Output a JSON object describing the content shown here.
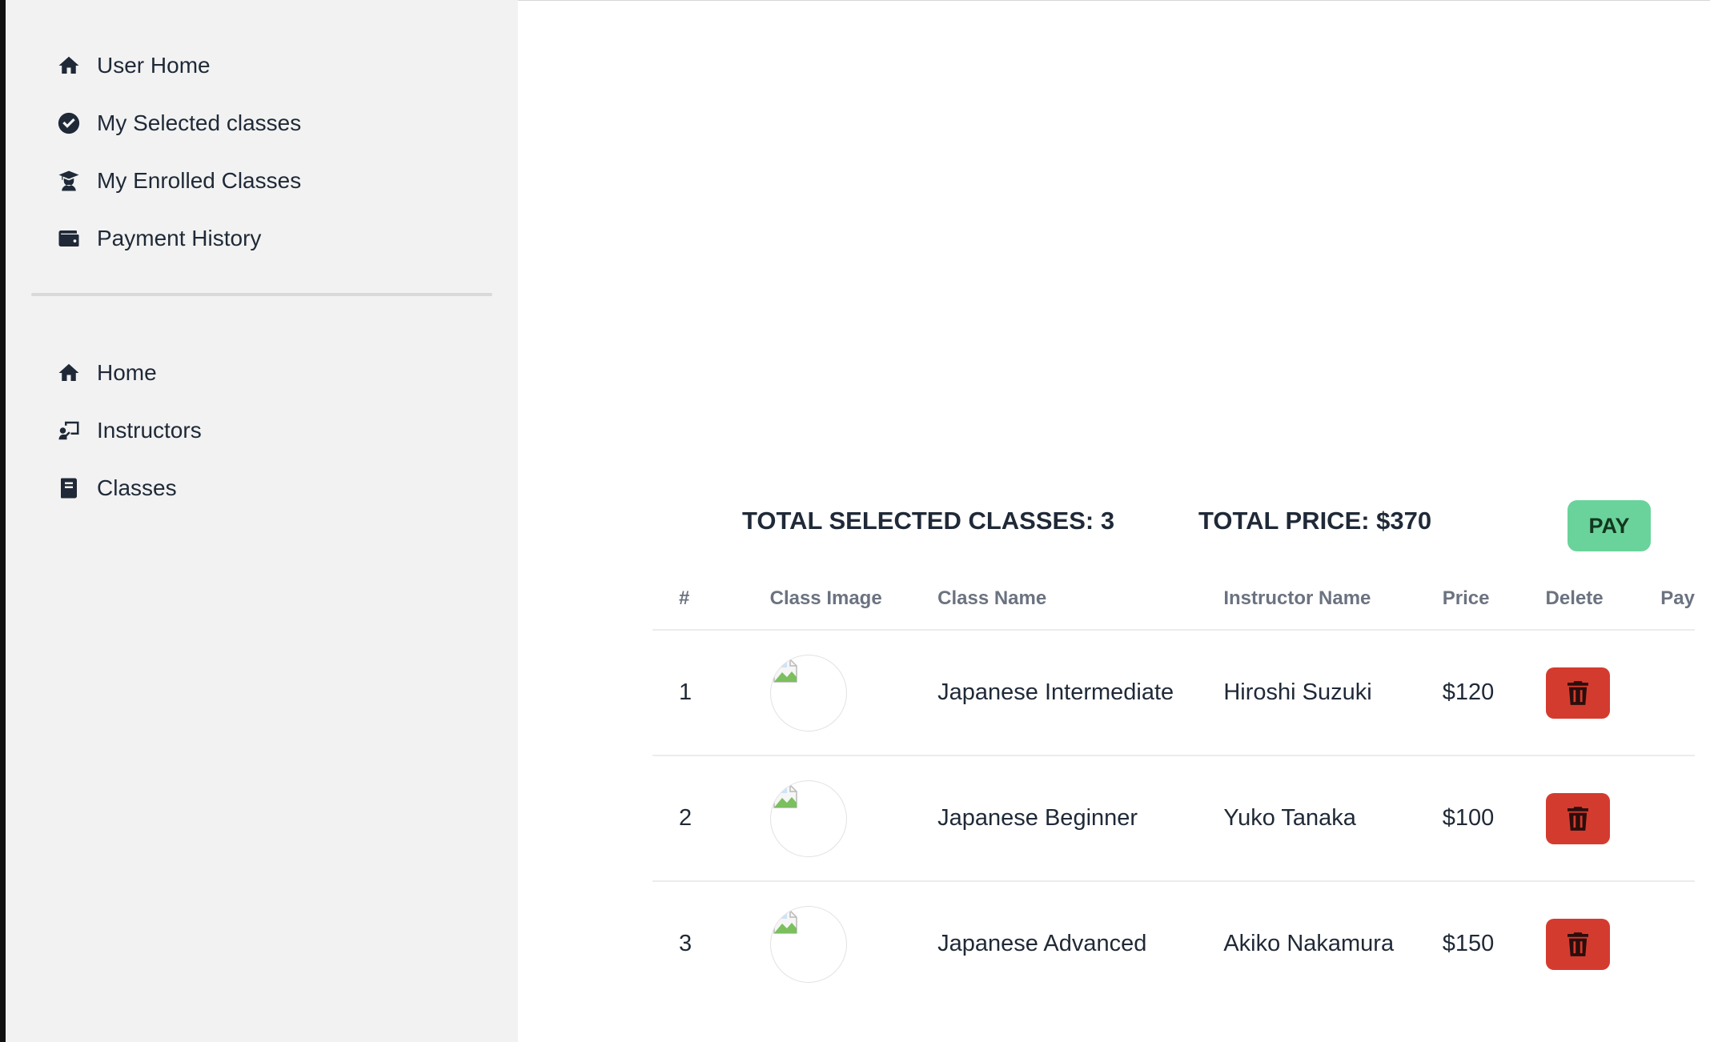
{
  "sidebar": {
    "primary": [
      {
        "label": "User Home",
        "icon": "home-icon"
      },
      {
        "label": "My Selected classes",
        "icon": "check-circle-icon"
      },
      {
        "label": "My Enrolled Classes",
        "icon": "graduate-icon"
      },
      {
        "label": "Payment History",
        "icon": "wallet-icon"
      }
    ],
    "secondary": [
      {
        "label": "Home",
        "icon": "home-icon"
      },
      {
        "label": "Instructors",
        "icon": "chalkboard-teacher-icon"
      },
      {
        "label": "Classes",
        "icon": "book-icon"
      }
    ]
  },
  "summary": {
    "total_classes": "TOTAL SELECTED CLASSES: 3",
    "total_price": "TOTAL PRICE: $370",
    "pay_label": "PAY"
  },
  "table": {
    "headers": [
      "#",
      "Class Image",
      "Class Name",
      "Instructor Name",
      "Price",
      "Delete",
      "Pay"
    ],
    "rows": [
      {
        "num": "1",
        "class_name": "Japanese Intermediate",
        "instructor": "Hiroshi Suzuki",
        "price": "$120"
      },
      {
        "num": "2",
        "class_name": "Japanese Beginner",
        "instructor": "Yuko Tanaka",
        "price": "$100"
      },
      {
        "num": "3",
        "class_name": "Japanese Advanced",
        "instructor": "Akiko Nakamura",
        "price": "$150"
      }
    ]
  },
  "colors": {
    "sidebar_bg": "#f2f2f2",
    "pay_button": "#6ad39b",
    "delete_button": "#d43b2f",
    "text": "#1f2937",
    "header_text": "#6b7280"
  }
}
